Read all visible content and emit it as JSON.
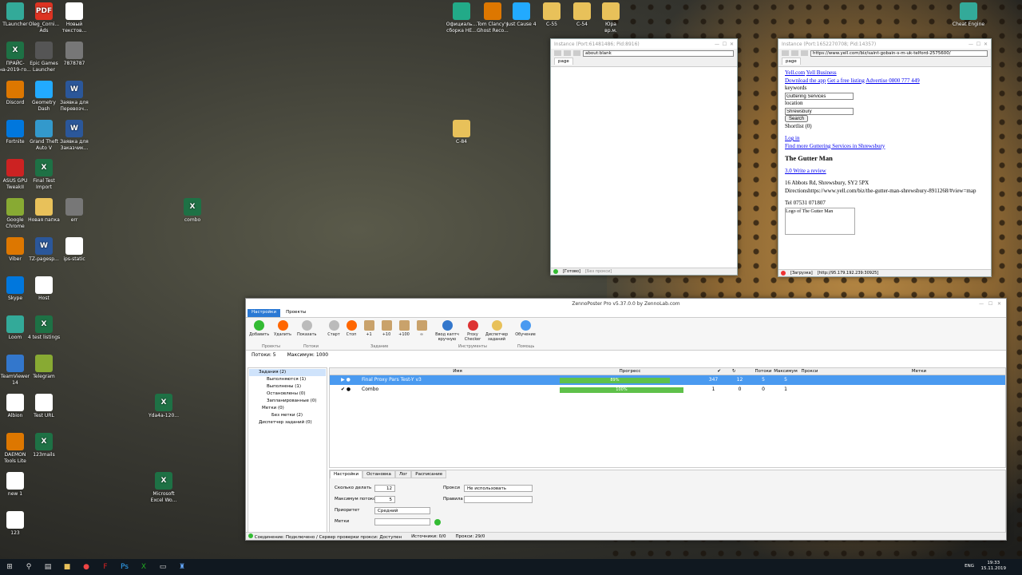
{
  "desktop": {
    "icons_left": [
      {
        "label": "TLauncher",
        "type": "app"
      },
      {
        "label": "Oleg_Corni...\nAds",
        "type": "pdf"
      },
      {
        "label": "Новый\nтекстов...",
        "type": "doc"
      },
      {
        "label": "ПРАЙС-\nна-2019-го...",
        "type": "xl"
      },
      {
        "label": "Epic Games\nLauncher",
        "type": "app"
      },
      {
        "label": "7878787",
        "type": "img"
      },
      {
        "label": "Discord",
        "type": "app"
      },
      {
        "label": "Geometry\nDash",
        "type": "app"
      },
      {
        "label": "Заявка для\nПеревозч...",
        "type": "wd"
      },
      {
        "label": "Fortnite",
        "type": "app"
      },
      {
        "label": "Grand Theft\nAuto V",
        "type": "app"
      },
      {
        "label": "Заявка для\nЗаказчик...",
        "type": "wd"
      },
      {
        "label": "ASUS GPU\nTweakII",
        "type": "app"
      },
      {
        "label": "Final Test\nImport",
        "type": "xl"
      },
      {
        "label": "Google\nChrome",
        "type": "app"
      },
      {
        "label": "Новая папка",
        "type": "fold"
      },
      {
        "label": "err",
        "type": "img"
      },
      {
        "label": "Viber",
        "type": "app"
      },
      {
        "label": "TZ-pagesp...",
        "type": "wd"
      },
      {
        "label": "ips-static",
        "type": "doc"
      },
      {
        "label": "Skype",
        "type": "app"
      },
      {
        "label": "Host",
        "type": "doc"
      },
      {
        "label": "Loom",
        "type": "app"
      },
      {
        "label": "4 test listings",
        "type": "xl"
      },
      {
        "label": "TeamViewer\n14",
        "type": "app"
      },
      {
        "label": "Telegram",
        "type": "app"
      },
      {
        "label": "Albion",
        "type": "doc"
      },
      {
        "label": "Test URL",
        "type": "doc"
      },
      {
        "label": "DAEMON\nTools Lite",
        "type": "app"
      },
      {
        "label": "123mails",
        "type": "xl"
      },
      {
        "label": "new 1",
        "type": "doc"
      },
      {
        "label": "123",
        "type": "doc"
      }
    ],
    "icons_misc": [
      {
        "label": "combo",
        "type": "xl"
      },
      {
        "label": "C-84",
        "type": "fold"
      },
      {
        "label": "Yda4a-120...",
        "type": "xl"
      },
      {
        "label": "Microsoft\nExcel Wo...",
        "type": "xl"
      }
    ],
    "icons_top": [
      {
        "label": "Официаль...\nсборка HE...",
        "type": "app"
      },
      {
        "label": "Tom Clancy's\nGhost Reco...",
        "type": "app"
      },
      {
        "label": "Just Cause 4",
        "type": "app"
      },
      {
        "label": "C-55",
        "type": "fold"
      },
      {
        "label": "C-54",
        "type": "fold"
      },
      {
        "label": "Юра\nвр.м.",
        "type": "fold"
      },
      {
        "label": "Cheat Engine",
        "type": "app"
      }
    ]
  },
  "browser1": {
    "title": "Instance (Port:61481486; Pid:8916)",
    "url": "about:blank",
    "tab": "page",
    "status_ready": "[Готово]",
    "status_proxy": "[Без прокси]"
  },
  "browser2": {
    "title": "Instance (Port:1652270708; Pid:14357)",
    "url": "https://www.yell.com/biz/saint-gobain-s-m-uk-telford-2575600/",
    "tab": "page",
    "status_load": "[Загрузка]",
    "status_proxy": "[http://95.179.192.239:30925]",
    "content": {
      "link1": "Yell.com",
      "link2": "Yell Business",
      "link3": "Download the app",
      "link4": "Get a free listing",
      "link5": "Advertise 0800 777 449",
      "keywords_label": "keywords",
      "keywords_value": "Guttering Services",
      "location_label": "location",
      "location_value": "Shrewsbury",
      "search_btn": "Search",
      "shortlist": "Shortlist (0)",
      "login": "Log in",
      "find_more": "Find more Guttering Services in Shrewsbury",
      "business": "The Gutter Man",
      "rating": "3.0 Write a review",
      "address": "16 Abbots Rd, Shrewsbury, SY2 5PX",
      "directions": "Directionshttps://www.yell.com/biz/the-gutter-man-shrewsbury-8911268/#view=map",
      "tel": "Tel 07531 071807",
      "logo_alt": "Logo of The Gutter Man"
    }
  },
  "zenno": {
    "title": "ZennoPoster Pro v5.37.0.0 by ZennoLab.com",
    "ribbon_tabs": [
      "Настройки",
      "Проекты"
    ],
    "buttons": [
      "Добавить",
      "Удалить",
      "Показать",
      "Старт",
      "Стоп",
      "+1",
      "+10",
      "+100",
      "∞",
      "Ввод каптч вручную",
      "Proxy Checker",
      "Диспетчер заданий",
      "Обучение"
    ],
    "groups": [
      "Проекты",
      "Потоки",
      "Задание",
      "Инструменты",
      "Помощь"
    ],
    "threads": "Потоки: 5",
    "max": "Максимум: 1000",
    "tree": [
      "Задания (2)",
      "Выполняются (1)",
      "Выполнены (1)",
      "Остановлены (0)",
      "Запланированные (0)",
      "Метки (0)",
      "Без метки (2)",
      "Диспетчер заданий (0)"
    ],
    "columns": [
      "Имя",
      "Прогресс",
      "Потоки",
      "Максимум",
      "Прокси",
      "Метки"
    ],
    "rows": [
      {
        "name": "Final Proxy Pars Test-Y v3",
        "progress": "89%",
        "pct": 89,
        "done": "347",
        "retries": "12",
        "threads": "5",
        "max": "5"
      },
      {
        "name": "Combo",
        "progress": "100%",
        "pct": 100,
        "done": "1",
        "retries": "0",
        "threads": "0",
        "max": "1"
      }
    ],
    "bottom_tabs": [
      "Настройки",
      "Остановка",
      "Лог",
      "Расписание"
    ],
    "fields": {
      "count_label": "Сколько делать",
      "count": "12",
      "maxthreads_label": "Максимум потоков",
      "maxthreads": "5",
      "priority_label": "Приоритет",
      "priority": "Средний",
      "tags_label": "Метки",
      "proxy_label": "Прокси",
      "proxy": "Не использовать",
      "rules_label": "Правила"
    },
    "status": {
      "conn": "Соединение: Подключено / Сервер проверки прокси: Доступен",
      "sources": "Источники: 0/0",
      "proxies": "Прокси: 29/0"
    }
  },
  "taskbar": {
    "lang": "ENG",
    "time": "19:33",
    "date": "15.11.2019"
  }
}
